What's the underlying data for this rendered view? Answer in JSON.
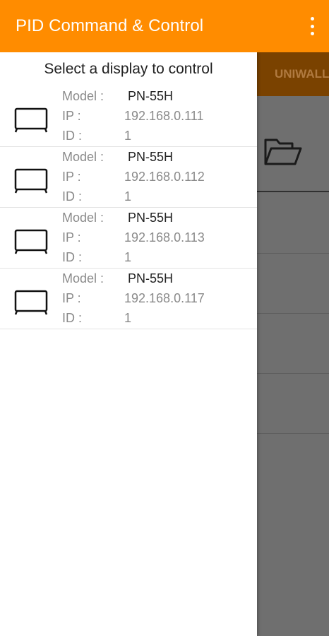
{
  "app": {
    "title": "PID Command & Control",
    "menu_icon": "more-vert-icon"
  },
  "drawer": {
    "title": "Select a display to control",
    "labels": {
      "model": "Model :",
      "ip": "IP :",
      "id": "ID :"
    },
    "displays": [
      {
        "model": "PN-55H",
        "ip": "192.168.0.111",
        "id": "1"
      },
      {
        "model": "PN-55H",
        "ip": "192.168.0.112",
        "id": "1"
      },
      {
        "model": "PN-55H",
        "ip": "192.168.0.113",
        "id": "1"
      },
      {
        "model": "PN-55H",
        "ip": "192.168.0.117",
        "id": "1"
      }
    ]
  },
  "main": {
    "tab_label": "UNIWALL",
    "folder_icon": "folder-open-icon"
  },
  "colors": {
    "accent": "#FF8C00",
    "scrim": "#6f6f6f",
    "tab_dim": "#7a4200"
  }
}
